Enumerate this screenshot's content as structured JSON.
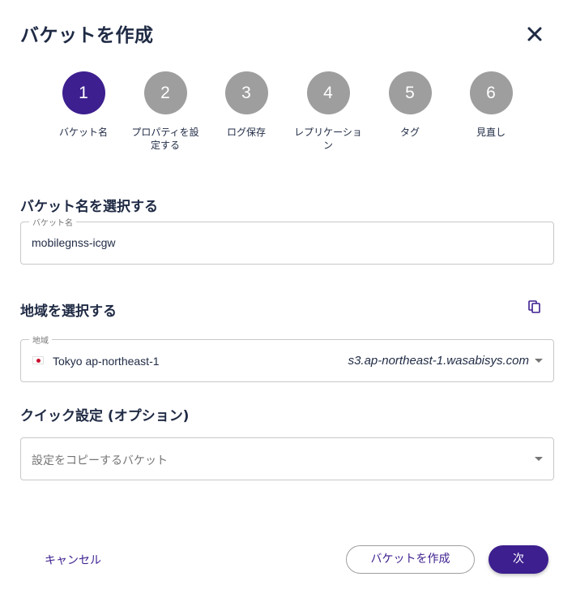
{
  "dialog": {
    "title": "バケットを作成"
  },
  "steps": [
    {
      "number": "1",
      "label": "バケット名"
    },
    {
      "number": "2",
      "label": "プロパティを設定する"
    },
    {
      "number": "3",
      "label": "ログ保存"
    },
    {
      "number": "4",
      "label": "レプリケーション"
    },
    {
      "number": "5",
      "label": "タグ"
    },
    {
      "number": "6",
      "label": "見直し"
    }
  ],
  "active_step": 1,
  "bucket_name": {
    "section_title": "バケット名を選択する",
    "field_label": "バケット名",
    "value": "mobilegnss-icgw"
  },
  "region": {
    "section_title": "地域を選択する",
    "field_label": "地域",
    "value": "Tokyo ap-northeast-1",
    "endpoint": "s3.ap-northeast-1.wasabisys.com"
  },
  "quick_settings": {
    "section_title": "クイック設定 (オプション)",
    "placeholder": "設定をコピーするバケット"
  },
  "footer": {
    "cancel_label": "キャンセル",
    "create_label": "バケットを作成",
    "next_label": "次"
  },
  "colors": {
    "accent": "#3d1f8f",
    "inactive_step": "#9e9e9e",
    "text": "#1f2a44"
  }
}
